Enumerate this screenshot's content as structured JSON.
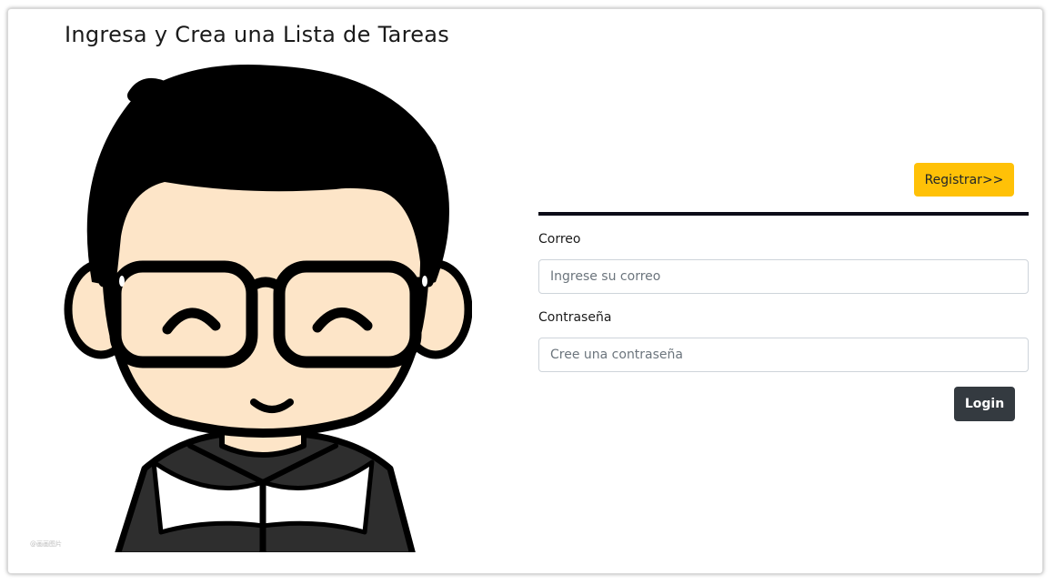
{
  "header": {
    "title": "Ingresa y Crea una Lista de Tareas"
  },
  "illustration": {
    "icon": "cartoon-boy-with-glasses",
    "watermark": "@画画图片",
    "colors": {
      "hair": "#000000",
      "skin": "#fde5c8",
      "jacket": "#2e2e2e",
      "collar": "#ffffff"
    }
  },
  "actions": {
    "register_label": "Registrar>>",
    "login_label": "Login"
  },
  "form": {
    "email": {
      "label": "Correo",
      "placeholder": "Ingrese su correo",
      "value": ""
    },
    "password": {
      "label": "Contraseña",
      "placeholder": "Cree una contraseña",
      "value": ""
    }
  },
  "colors": {
    "register_button": "#ffc107",
    "login_button": "#343a40",
    "divider": "#0c0c18"
  }
}
